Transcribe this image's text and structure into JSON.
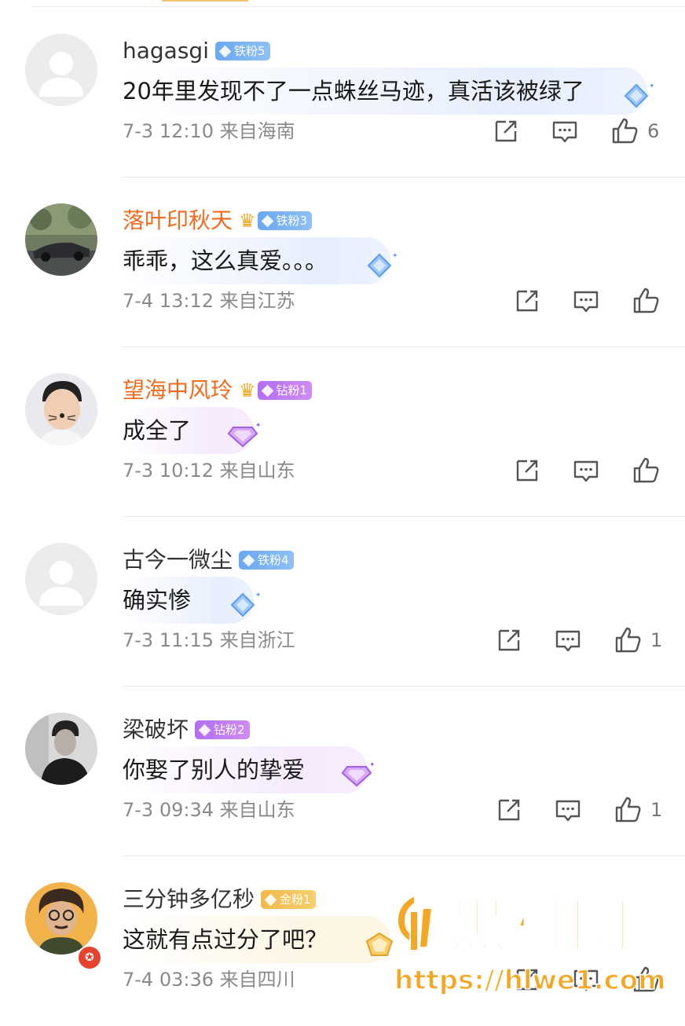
{
  "comments": [
    {
      "username": "hagasgi",
      "name_color": "gray",
      "crown": false,
      "fan_badge": {
        "label": "铁粉5",
        "tier": "iron"
      },
      "text": "20年里发现不了一点蛛丝马迹，真活该被绿了",
      "bubble_style": "blue",
      "time": "7-3 12:10",
      "location": "来自海南",
      "likes": "6",
      "avatar": "default-avatar"
    },
    {
      "username": "落叶印秋天",
      "name_color": "orange",
      "crown": true,
      "fan_badge": {
        "label": "铁粉3",
        "tier": "iron"
      },
      "text": "乖乖，这么真爱。。。",
      "bubble_style": "blue",
      "time": "7-4 13:12",
      "location": "来自江苏",
      "likes": "",
      "avatar": "car-photo-avatar"
    },
    {
      "username": "望海中风玲",
      "name_color": "orange",
      "crown": true,
      "fan_badge": {
        "label": "钻粉1",
        "tier": "diamond"
      },
      "text": "成全了",
      "bubble_style": "purple",
      "time": "7-3 10:12",
      "location": "来自山东",
      "likes": "",
      "avatar": "boy-photo-avatar"
    },
    {
      "username": "古今一微尘",
      "name_color": "gray",
      "crown": false,
      "fan_badge": {
        "label": "铁粉4",
        "tier": "iron"
      },
      "text": "确实惨",
      "bubble_style": "blue",
      "time": "7-3 11:15",
      "location": "来自浙江",
      "likes": "1",
      "avatar": "default-avatar"
    },
    {
      "username": "梁破坏",
      "name_color": "gray",
      "crown": false,
      "fan_badge": {
        "label": "钻粉2",
        "tier": "diamond"
      },
      "text": "你娶了别人的挚爱",
      "bubble_style": "purple",
      "time": "7-3 09:34",
      "location": "来自山东",
      "likes": "1",
      "avatar": "man-bw-photo-avatar"
    },
    {
      "username": "三分钟多亿秒",
      "name_color": "gray",
      "crown": false,
      "fan_badge": {
        "label": "金粉1",
        "tier": "gold"
      },
      "text": "这就有点过分了吧？",
      "bubble_style": "gold",
      "time": "7-4 03:36",
      "location": "来自四川",
      "likes": "",
      "avatar": "cartoon-man-avatar"
    }
  ],
  "watermark": {
    "title": "黑料网",
    "url": "https://hlwe1.com"
  },
  "colors": {
    "orange_name": "#f26b1d",
    "iron_badge": "#6aa8f0",
    "diamond_badge": "#b26ef0",
    "gold_badge": "#f2b94a",
    "meta_gray": "#8a8a8a",
    "watermark": "#f5a623"
  }
}
